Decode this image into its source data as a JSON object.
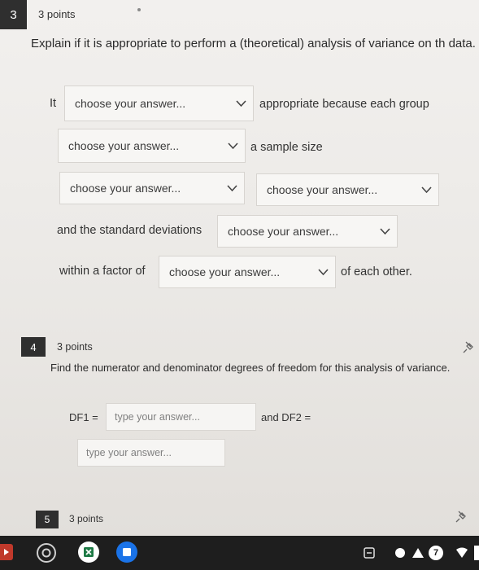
{
  "questions": [
    {
      "number": "3",
      "points": "3 points",
      "prompt": "Explain if it is appropriate to perform a (theoretical) analysis of variance on th data.",
      "sentence": {
        "it": "It",
        "appropriate_text": "appropriate because each group",
        "sample_size_text": "a sample size",
        "stdev_text": "and the standard deviations",
        "within_text": "within a factor of",
        "each_other_text": "of each other."
      },
      "dropdown_placeholder": "choose your answer..."
    },
    {
      "number": "4",
      "points": "3 points",
      "prompt": "Find the numerator and denominator degrees of freedom for this analysis of variance.",
      "df1_label": "DF1 =",
      "df2_label": "and DF2 =",
      "input_placeholder": "type your answer..."
    },
    {
      "number": "5",
      "points": "3 points"
    }
  ],
  "shelf": {
    "badge": "7",
    "icons": [
      "screenshot-icon",
      "chrome-icon",
      "excel-icon",
      "files-icon",
      "tray-icon",
      "circle-icon",
      "drive-icon",
      "notification-icon",
      "wifi-icon"
    ]
  },
  "colors": {
    "qnum_bg": "#2f2f2f",
    "shelf_bg": "#1e1e1e",
    "excel_green": "#1e7a45"
  }
}
